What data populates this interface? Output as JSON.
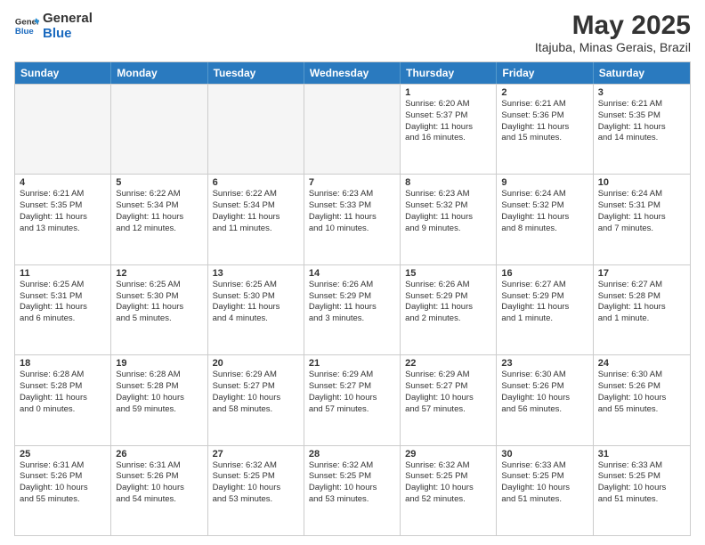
{
  "logo": {
    "line1": "General",
    "line2": "Blue"
  },
  "title": "May 2025",
  "subtitle": "Itajuba, Minas Gerais, Brazil",
  "header_days": [
    "Sunday",
    "Monday",
    "Tuesday",
    "Wednesday",
    "Thursday",
    "Friday",
    "Saturday"
  ],
  "weeks": [
    [
      {
        "day": "",
        "info": ""
      },
      {
        "day": "",
        "info": ""
      },
      {
        "day": "",
        "info": ""
      },
      {
        "day": "",
        "info": ""
      },
      {
        "day": "1",
        "info": "Sunrise: 6:20 AM\nSunset: 5:37 PM\nDaylight: 11 hours\nand 16 minutes."
      },
      {
        "day": "2",
        "info": "Sunrise: 6:21 AM\nSunset: 5:36 PM\nDaylight: 11 hours\nand 15 minutes."
      },
      {
        "day": "3",
        "info": "Sunrise: 6:21 AM\nSunset: 5:35 PM\nDaylight: 11 hours\nand 14 minutes."
      }
    ],
    [
      {
        "day": "4",
        "info": "Sunrise: 6:21 AM\nSunset: 5:35 PM\nDaylight: 11 hours\nand 13 minutes."
      },
      {
        "day": "5",
        "info": "Sunrise: 6:22 AM\nSunset: 5:34 PM\nDaylight: 11 hours\nand 12 minutes."
      },
      {
        "day": "6",
        "info": "Sunrise: 6:22 AM\nSunset: 5:34 PM\nDaylight: 11 hours\nand 11 minutes."
      },
      {
        "day": "7",
        "info": "Sunrise: 6:23 AM\nSunset: 5:33 PM\nDaylight: 11 hours\nand 10 minutes."
      },
      {
        "day": "8",
        "info": "Sunrise: 6:23 AM\nSunset: 5:32 PM\nDaylight: 11 hours\nand 9 minutes."
      },
      {
        "day": "9",
        "info": "Sunrise: 6:24 AM\nSunset: 5:32 PM\nDaylight: 11 hours\nand 8 minutes."
      },
      {
        "day": "10",
        "info": "Sunrise: 6:24 AM\nSunset: 5:31 PM\nDaylight: 11 hours\nand 7 minutes."
      }
    ],
    [
      {
        "day": "11",
        "info": "Sunrise: 6:25 AM\nSunset: 5:31 PM\nDaylight: 11 hours\nand 6 minutes."
      },
      {
        "day": "12",
        "info": "Sunrise: 6:25 AM\nSunset: 5:30 PM\nDaylight: 11 hours\nand 5 minutes."
      },
      {
        "day": "13",
        "info": "Sunrise: 6:25 AM\nSunset: 5:30 PM\nDaylight: 11 hours\nand 4 minutes."
      },
      {
        "day": "14",
        "info": "Sunrise: 6:26 AM\nSunset: 5:29 PM\nDaylight: 11 hours\nand 3 minutes."
      },
      {
        "day": "15",
        "info": "Sunrise: 6:26 AM\nSunset: 5:29 PM\nDaylight: 11 hours\nand 2 minutes."
      },
      {
        "day": "16",
        "info": "Sunrise: 6:27 AM\nSunset: 5:29 PM\nDaylight: 11 hours\nand 1 minute."
      },
      {
        "day": "17",
        "info": "Sunrise: 6:27 AM\nSunset: 5:28 PM\nDaylight: 11 hours\nand 1 minute."
      }
    ],
    [
      {
        "day": "18",
        "info": "Sunrise: 6:28 AM\nSunset: 5:28 PM\nDaylight: 11 hours\nand 0 minutes."
      },
      {
        "day": "19",
        "info": "Sunrise: 6:28 AM\nSunset: 5:28 PM\nDaylight: 10 hours\nand 59 minutes."
      },
      {
        "day": "20",
        "info": "Sunrise: 6:29 AM\nSunset: 5:27 PM\nDaylight: 10 hours\nand 58 minutes."
      },
      {
        "day": "21",
        "info": "Sunrise: 6:29 AM\nSunset: 5:27 PM\nDaylight: 10 hours\nand 57 minutes."
      },
      {
        "day": "22",
        "info": "Sunrise: 6:29 AM\nSunset: 5:27 PM\nDaylight: 10 hours\nand 57 minutes."
      },
      {
        "day": "23",
        "info": "Sunrise: 6:30 AM\nSunset: 5:26 PM\nDaylight: 10 hours\nand 56 minutes."
      },
      {
        "day": "24",
        "info": "Sunrise: 6:30 AM\nSunset: 5:26 PM\nDaylight: 10 hours\nand 55 minutes."
      }
    ],
    [
      {
        "day": "25",
        "info": "Sunrise: 6:31 AM\nSunset: 5:26 PM\nDaylight: 10 hours\nand 55 minutes."
      },
      {
        "day": "26",
        "info": "Sunrise: 6:31 AM\nSunset: 5:26 PM\nDaylight: 10 hours\nand 54 minutes."
      },
      {
        "day": "27",
        "info": "Sunrise: 6:32 AM\nSunset: 5:25 PM\nDaylight: 10 hours\nand 53 minutes."
      },
      {
        "day": "28",
        "info": "Sunrise: 6:32 AM\nSunset: 5:25 PM\nDaylight: 10 hours\nand 53 minutes."
      },
      {
        "day": "29",
        "info": "Sunrise: 6:32 AM\nSunset: 5:25 PM\nDaylight: 10 hours\nand 52 minutes."
      },
      {
        "day": "30",
        "info": "Sunrise: 6:33 AM\nSunset: 5:25 PM\nDaylight: 10 hours\nand 51 minutes."
      },
      {
        "day": "31",
        "info": "Sunrise: 6:33 AM\nSunset: 5:25 PM\nDaylight: 10 hours\nand 51 minutes."
      }
    ]
  ]
}
